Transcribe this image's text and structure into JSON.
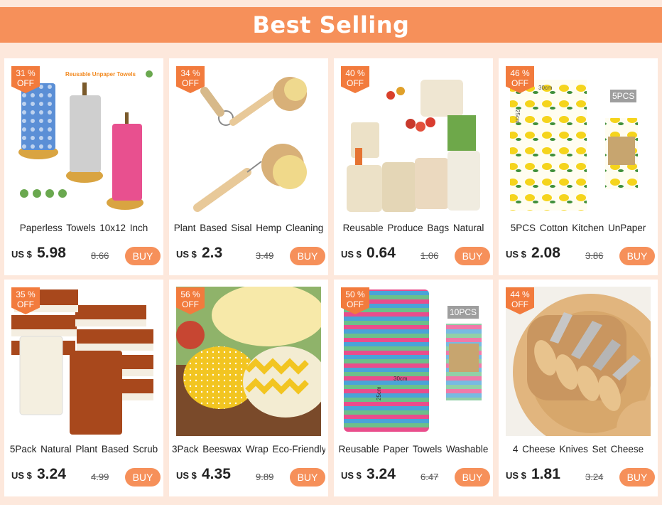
{
  "header": {
    "title": "Best Selling"
  },
  "currency_label": "US $",
  "buy_label": "BUY",
  "off_label": "OFF",
  "products": [
    {
      "discount": "31 %",
      "title": "Paperless Towels 10x12 Inch",
      "price": "5.98",
      "old_price": "8.66",
      "image": "reusable-towels-image",
      "image_text": "Reusable Unpaper Towels"
    },
    {
      "discount": "34 %",
      "title": "Plant Based Sisal Hemp Cleaning",
      "price": "2.3",
      "old_price": "3.49",
      "image": "cleaning-brush-image"
    },
    {
      "discount": "40 %",
      "title": "Reusable Produce Bags Natural",
      "price": "0.64",
      "old_price": "1.06",
      "image": "produce-bags-image"
    },
    {
      "discount": "46 %",
      "title": "5PCS Cotton Kitchen UnPaper",
      "price": "2.08",
      "old_price": "3.86",
      "image": "lemon-towels-image",
      "image_tag": "5PCS",
      "size_w": "30cm",
      "size_h": "25cm"
    },
    {
      "discount": "35 %",
      "title": "5Pack Natural Plant Based Scrub",
      "price": "3.24",
      "old_price": "4.99",
      "image": "scrub-sponges-image"
    },
    {
      "discount": "56 %",
      "title": "3Pack Beeswax Wrap Eco-Friendly",
      "price": "4.35",
      "old_price": "9.89",
      "image": "beeswax-wraps-image"
    },
    {
      "discount": "50 %",
      "title": "Reusable Paper Towels Washable",
      "price": "3.24",
      "old_price": "6.47",
      "image": "heart-towels-image",
      "image_tag": "10PCS",
      "size_w": "30cm",
      "size_h": "25cm"
    },
    {
      "discount": "44 %",
      "title": "4 Cheese Knives Set Cheese",
      "price": "1.81",
      "old_price": "3.24",
      "image": "cheese-knives-image"
    }
  ],
  "colors": {
    "banner": "#f6905a",
    "badge": "#f27b3d",
    "button": "#f6905a",
    "page_bg": "#fde8dc"
  }
}
